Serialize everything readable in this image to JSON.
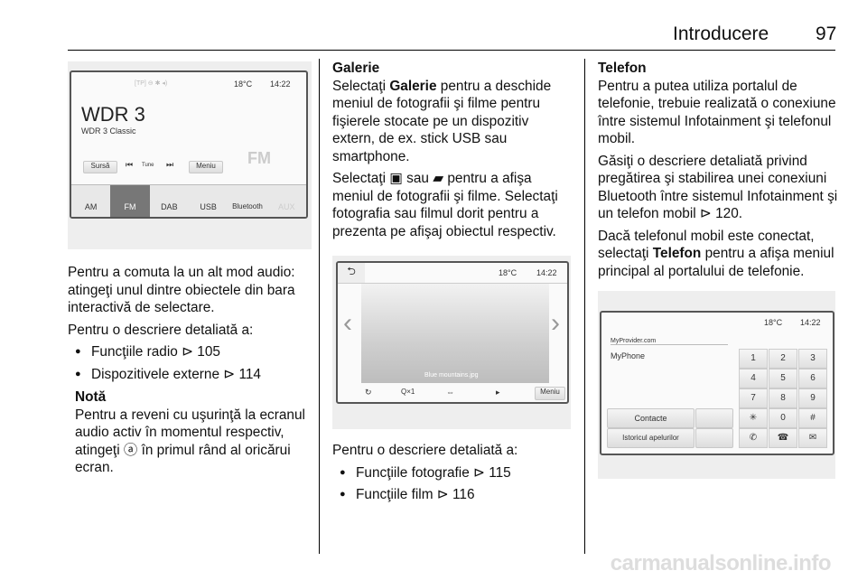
{
  "header": {
    "title": "Introducere",
    "page": "97"
  },
  "col1": {
    "screen": {
      "status_icons": "[TP] ⊖ ✱ ◂)",
      "temp": "18°C",
      "time": "14:22",
      "station": "WDR 3",
      "substation": "WDR 3 Classic",
      "source_btn": "Sursă",
      "tune": "Tune",
      "menu_btn": "Meniu",
      "fm_badge": "FM",
      "tabs": [
        "AM",
        "FM",
        "DAB",
        "USB",
        "Bluetooth",
        "AUX"
      ]
    },
    "p1": "Pentru a comuta la un alt mod audio: atingeţi unul dintre obiectele din bara interactivă de selectare.",
    "p2": "Pentru o descriere detaliată a:",
    "bullets": [
      "Funcţiile radio ⊳ 105",
      "Dispozitivele externe ⊳ 114"
    ],
    "note_title": "Notă",
    "note": "Pentru a reveni cu uşurinţă la ecranul audio activ în momentul respectiv, atingeţi ⓐ în primul rând al oricărui ecran."
  },
  "col2": {
    "title": "Galerie",
    "p1_pre": "Selectaţi ",
    "p1_bold": "Galerie",
    "p1_post": " pentru a deschide meniul de fotografii şi filme pentru fişierele stocate pe un dispozitiv extern, de ex. stick USB sau smartphone.",
    "p2": "Selectaţi ▣ sau ▰ pentru a afişa meniul de fotografii şi filme. Selectaţi fotografia sau filmul dorit pentru a prezenta pe afişaj obiectul respectiv.",
    "screen": {
      "temp": "18°C",
      "time": "14:22",
      "caption": "Blue mountains.jpg",
      "zoom": "Q×1",
      "menu_btn": "Meniu"
    },
    "p3": "Pentru o descriere detaliată a:",
    "bullets": [
      "Funcţiile fotografie ⊳ 115",
      "Funcţiile film ⊳ 116"
    ]
  },
  "col3": {
    "title": "Telefon",
    "p1": "Pentru a putea utiliza portalul de telefonie, trebuie realizată o conexiune între sistemul Infotainment şi telefonul mobil.",
    "p2": "Găsiţi o descriere detaliată privind pregătirea şi stabilirea unei conexiuni Bluetooth între sistemul Infotainment şi un telefon mobil ⊳ 120.",
    "p3_pre": "Dacă telefonul mobil este conectat, selectaţi ",
    "p3_bold": "Telefon",
    "p3_post": " pentru a afişa meniul principal al portalului de telefonie.",
    "screen": {
      "temp": "18°C",
      "time": "14:22",
      "provider": "MyProvider.com",
      "phone": "MyPhone",
      "contacts_btn": "Contacte",
      "history_btn": "Istoricul apelurilor",
      "keys": [
        "1",
        "2",
        "3",
        "4",
        "5",
        "6",
        "7",
        "8",
        "9",
        "✳",
        "0",
        "#"
      ]
    }
  },
  "watermark": "carmanualsonline.info"
}
